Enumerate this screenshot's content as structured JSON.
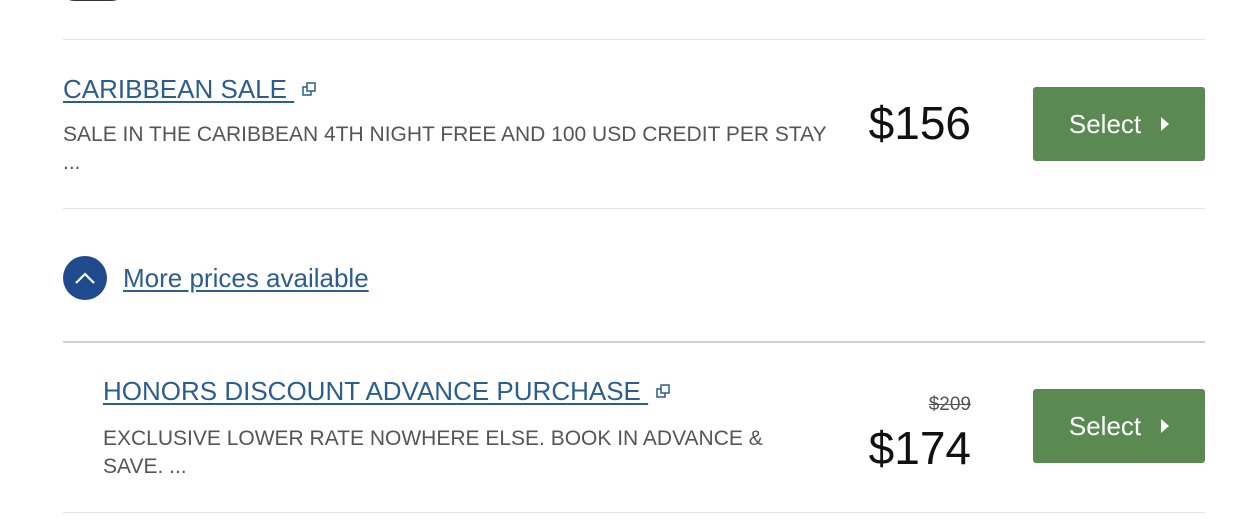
{
  "rates": [
    {
      "title": "CARIBBEAN SALE",
      "description": "SALE IN THE CARIBBEAN 4TH NIGHT FREE AND 100 USD CREDIT PER STAY ...",
      "price": "$156",
      "button_label": "Select"
    },
    {
      "title": "HONORS DISCOUNT ADVANCE PURCHASE",
      "description": "EXCLUSIVE LOWER RATE NOWHERE ELSE. BOOK IN ADVANCE & SAVE. ...",
      "old_price": "$209",
      "price": "$174",
      "button_label": "Select"
    }
  ],
  "more_prices": {
    "label": "More prices available"
  },
  "colors": {
    "link": "#2c5d8f",
    "button": "#5a8a52",
    "circle": "#1f4a8c"
  },
  "icons": [
    "external-link-icon",
    "chevron-right-icon",
    "chevron-up-icon"
  ]
}
